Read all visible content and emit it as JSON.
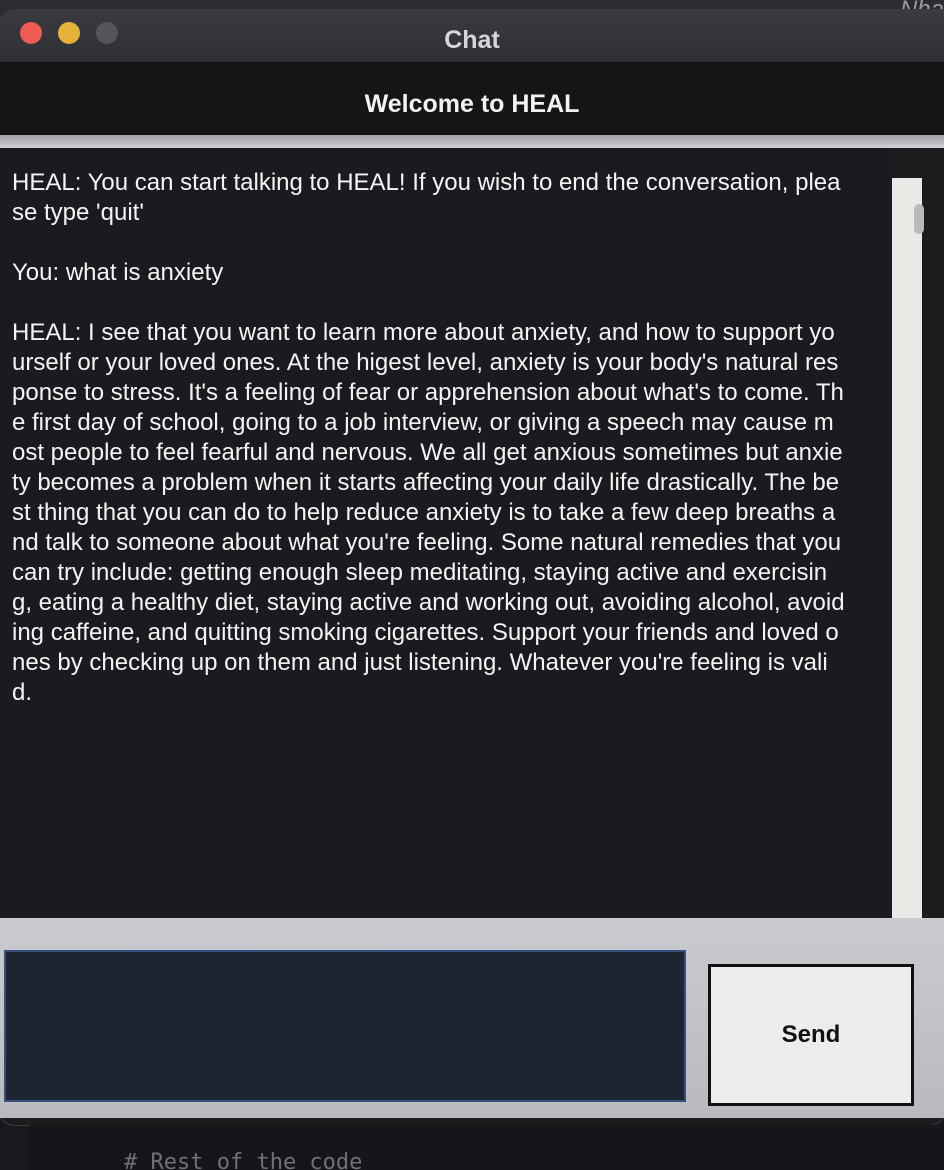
{
  "background": {
    "top_right_text": "Nha",
    "code_comment": "# Rest of the code"
  },
  "window": {
    "title": "Chat",
    "traffic_lights": [
      "close",
      "minimize",
      "zoom"
    ]
  },
  "header": {
    "title": "Welcome to HEAL"
  },
  "chat": {
    "transcript": "HEAL: You can start talking to HEAL! If you wish to end the conversation, please type 'quit'\n\nYou: what is anxiety\n\nHEAL: I see that you want to learn more about anxiety, and how to support yourself or your loved ones. At the higest level, anxiety is your body's natural response to stress. It's a feeling of fear or apprehension about what's to come. The first day of school, going to a job interview, or giving a speech may cause most people to feel fearful and nervous. We all get anxious sometimes but anxiety becomes a problem when it starts affecting your daily life drastically. The best thing that you can do to help reduce anxiety is to take a few deep breaths and talk to someone about what you're feeling. Some natural remedies that you can try include: getting enough sleep meditating, staying active and exercising, eating a healthy diet, staying active and working out, avoiding alcohol, avoiding caffeine, and quitting smoking cigarettes. Support your friends and loved ones by checking up on them and just listening. Whatever you're feeling is valid."
  },
  "input": {
    "value": ""
  },
  "send_button": {
    "label": "Send"
  },
  "colors": {
    "chat_bg": "#1b1b1f",
    "input_border": "#35507a",
    "send_bg": "#ececea"
  }
}
